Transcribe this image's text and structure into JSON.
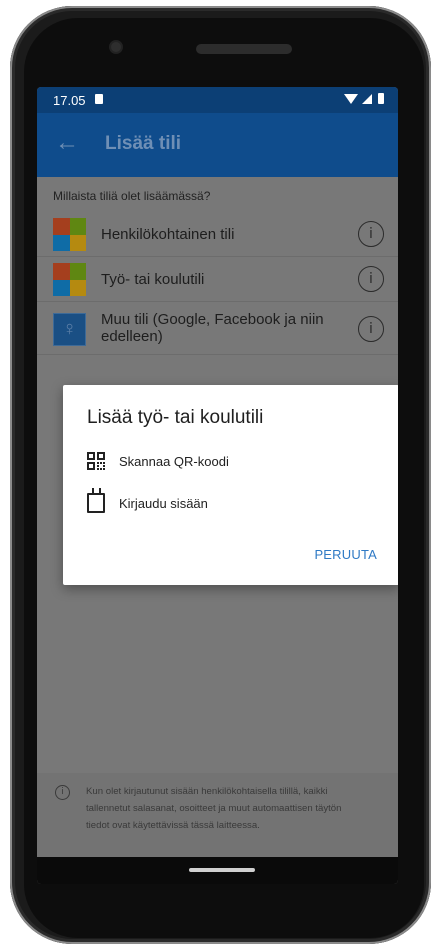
{
  "status": {
    "time": "17.05"
  },
  "appbar": {
    "back_glyph": "←",
    "title": "Lisää tili"
  },
  "question": "Millaista tiliä olet lisäämässä?",
  "options": [
    {
      "label": "Henkilökohtainen tili",
      "icon": "microsoft-logo-icon"
    },
    {
      "label": "Työ- tai koulutili",
      "icon": "microsoft-logo-icon"
    },
    {
      "label_line1": "Muu tili (Google, Facebook ja niin",
      "label_line2": "edelleen)",
      "icon": "person-badge-icon"
    }
  ],
  "info_glyph": "i",
  "dialog": {
    "title": "Lisää työ- tai koulutili",
    "items": [
      {
        "label": "Skannaa QR-koodi",
        "icon": "qr-code-icon"
      },
      {
        "label": "Kirjaudu sisään",
        "icon": "id-badge-icon"
      }
    ],
    "cancel_label": "PERUUTA"
  },
  "footer": {
    "line1": "Kun olet kirjautunut sisään henkilökohtaisella tilillä, kaikki",
    "line2": "tallennetut salasanat, osoitteet ja muut automaattisen täytön",
    "line3": "tiedot ovat käytettävissä tässä laitteessa."
  },
  "colors": {
    "appbar": "#0f4c8c",
    "statusbar": "#0c3f75",
    "accent": "#2f7ac5",
    "scrim_background": "#787878",
    "ms_red": "#a53f1e",
    "ms_green": "#5f8712",
    "ms_blue": "#0f6ca6",
    "ms_yellow": "#b58a10"
  }
}
